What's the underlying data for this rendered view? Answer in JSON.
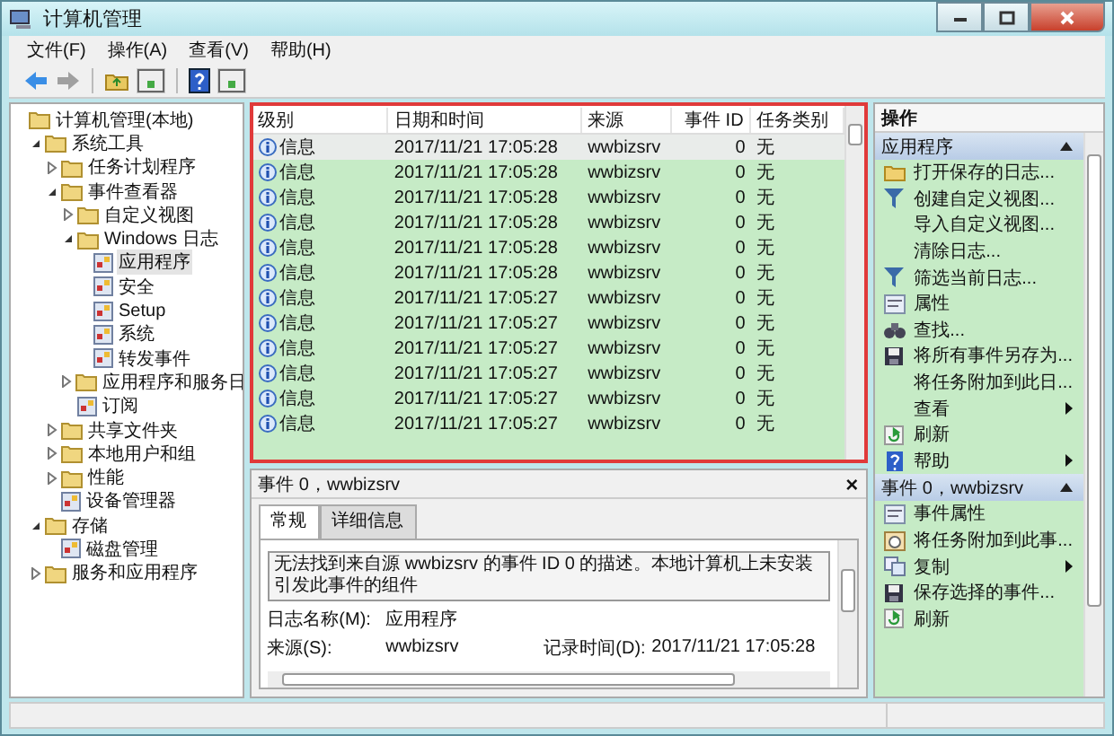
{
  "window": {
    "title": "计算机管理"
  },
  "menu": [
    "文件(F)",
    "操作(A)",
    "查看(V)",
    "帮助(H)"
  ],
  "tree": [
    {
      "label": "计算机管理(本地)",
      "selected": false,
      "children": [
        {
          "label": "系统工具",
          "expanded": true,
          "selected": false,
          "children": [
            {
              "label": "任务计划程序",
              "expanded": false,
              "selected": false
            },
            {
              "label": "事件查看器",
              "expanded": true,
              "selected": false,
              "children": [
                {
                  "label": "自定义视图",
                  "expanded": false,
                  "selected": false
                },
                {
                  "label": "Windows 日志",
                  "expanded": true,
                  "selected": false,
                  "children": [
                    {
                      "label": "应用程序",
                      "selected": true
                    },
                    {
                      "label": "安全",
                      "selected": false
                    },
                    {
                      "label": "Setup",
                      "selected": false
                    },
                    {
                      "label": "系统",
                      "selected": false
                    },
                    {
                      "label": "转发事件",
                      "selected": false
                    }
                  ]
                },
                {
                  "label": "应用程序和服务日",
                  "expanded": false,
                  "selected": false
                },
                {
                  "label": "订阅",
                  "selected": false
                }
              ]
            },
            {
              "label": "共享文件夹",
              "expanded": false,
              "selected": false
            },
            {
              "label": "本地用户和组",
              "expanded": false,
              "selected": false
            },
            {
              "label": "性能",
              "expanded": false,
              "selected": false
            },
            {
              "label": "设备管理器",
              "selected": false
            }
          ]
        },
        {
          "label": "存储",
          "expanded": true,
          "selected": false,
          "children": [
            {
              "label": "磁盘管理",
              "selected": false
            }
          ]
        },
        {
          "label": "服务和应用程序",
          "expanded": false,
          "selected": false
        }
      ]
    }
  ],
  "table": {
    "columns": [
      "级别",
      "日期和时间",
      "来源",
      "事件 ID",
      "任务类别"
    ],
    "rows": [
      {
        "level": "信息",
        "time": "2017/11/21 17:05:28",
        "source": "wwbizsrv",
        "id": "0",
        "category": "无",
        "selected": true
      },
      {
        "level": "信息",
        "time": "2017/11/21 17:05:28",
        "source": "wwbizsrv",
        "id": "0",
        "category": "无",
        "selected": false
      },
      {
        "level": "信息",
        "time": "2017/11/21 17:05:28",
        "source": "wwbizsrv",
        "id": "0",
        "category": "无",
        "selected": false
      },
      {
        "level": "信息",
        "time": "2017/11/21 17:05:28",
        "source": "wwbizsrv",
        "id": "0",
        "category": "无",
        "selected": false
      },
      {
        "level": "信息",
        "time": "2017/11/21 17:05:28",
        "source": "wwbizsrv",
        "id": "0",
        "category": "无",
        "selected": false
      },
      {
        "level": "信息",
        "time": "2017/11/21 17:05:28",
        "source": "wwbizsrv",
        "id": "0",
        "category": "无",
        "selected": false
      },
      {
        "level": "信息",
        "time": "2017/11/21 17:05:27",
        "source": "wwbizsrv",
        "id": "0",
        "category": "无",
        "selected": false
      },
      {
        "level": "信息",
        "time": "2017/11/21 17:05:27",
        "source": "wwbizsrv",
        "id": "0",
        "category": "无",
        "selected": false
      },
      {
        "level": "信息",
        "time": "2017/11/21 17:05:27",
        "source": "wwbizsrv",
        "id": "0",
        "category": "无",
        "selected": false
      },
      {
        "level": "信息",
        "time": "2017/11/21 17:05:27",
        "source": "wwbizsrv",
        "id": "0",
        "category": "无",
        "selected": false
      },
      {
        "level": "信息",
        "time": "2017/11/21 17:05:27",
        "source": "wwbizsrv",
        "id": "0",
        "category": "无",
        "selected": false
      },
      {
        "level": "信息",
        "time": "2017/11/21 17:05:27",
        "source": "wwbizsrv",
        "id": "0",
        "category": "无",
        "selected": false
      }
    ]
  },
  "detail": {
    "title": "事件 0，wwbizsrv",
    "close": "×",
    "tabs": [
      {
        "label": "常规",
        "selected": true
      },
      {
        "label": "详细信息",
        "selected": false
      }
    ],
    "description": "无法找到来自源 wwbizsrv 的事件 ID 0 的描述。本地计算机上未安装引发此事件的组件",
    "fields": [
      {
        "label": "日志名称(M):",
        "value": "应用程序"
      },
      {
        "label": "来源(S):",
        "value": "wwbizsrv",
        "extra_label": "记录时间(D):",
        "extra_value": "2017/11/21 17:05:28"
      }
    ]
  },
  "actions": {
    "title": "操作",
    "sections": [
      {
        "title": "应用程序",
        "items": [
          {
            "label": "打开保存的日志...",
            "kind": "folder",
            "submenu": false
          },
          {
            "label": "创建自定义视图...",
            "kind": "filter",
            "submenu": false
          },
          {
            "label": "导入自定义视图...",
            "kind": "plain",
            "submenu": false
          },
          {
            "label": "清除日志...",
            "kind": "plain",
            "submenu": false
          },
          {
            "label": "筛选当前日志...",
            "kind": "filter",
            "submenu": false
          },
          {
            "label": "属性",
            "kind": "properties",
            "submenu": false
          },
          {
            "label": "查找...",
            "kind": "find",
            "submenu": false
          },
          {
            "label": "将所有事件另存为...",
            "kind": "save",
            "submenu": false
          },
          {
            "label": "将任务附加到此日...",
            "kind": "plain",
            "submenu": false
          },
          {
            "label": "查看",
            "kind": "plain",
            "submenu": true
          },
          {
            "label": "刷新",
            "kind": "refresh",
            "submenu": false
          },
          {
            "label": "帮助",
            "kind": "help",
            "submenu": true
          }
        ]
      },
      {
        "title": "事件 0，wwbizsrv",
        "items": [
          {
            "label": "事件属性",
            "kind": "properties",
            "submenu": false
          },
          {
            "label": "将任务附加到此事...",
            "kind": "task",
            "submenu": false
          },
          {
            "label": "复制",
            "kind": "copy",
            "submenu": true
          },
          {
            "label": "保存选择的事件...",
            "kind": "save",
            "submenu": false
          },
          {
            "label": "刷新",
            "kind": "refresh",
            "submenu": false
          }
        ]
      }
    ]
  }
}
